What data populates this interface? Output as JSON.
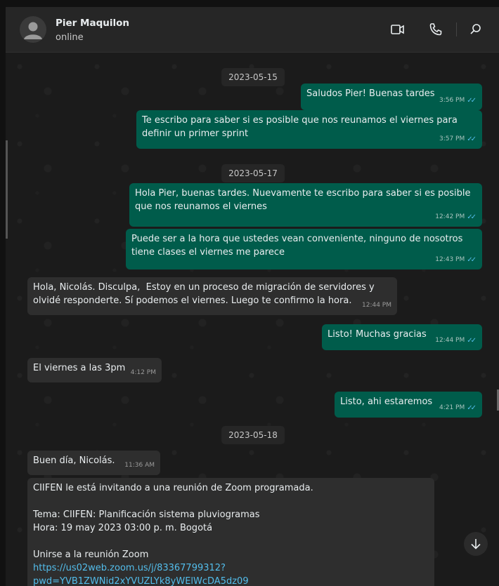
{
  "contact": {
    "name": "Pier Maquilon",
    "status": "online"
  },
  "icons": {
    "video": "video-call-icon",
    "voice": "voice-call-icon",
    "search": "search-icon",
    "scroll": "arrow-down-icon",
    "avatar": "person-avatar-icon"
  },
  "colors": {
    "outgoing": "#005c4b",
    "incoming": "#2e2e2e",
    "tick": "#53bdeb",
    "header": "#262626"
  },
  "dates": [
    "2023-05-15",
    "2023-05-17",
    "2023-05-18"
  ],
  "messages": [
    {
      "text": "Saludos Pier! Buenas tardes",
      "time": "3:56 PM",
      "read": "✓✓"
    },
    {
      "text": "Te escribo para saber si es posible que nos reunamos el viernes para definir un primer sprint",
      "time": "3:57 PM",
      "read": "✓✓"
    },
    {
      "text": "Hola Pier, buenas tardes. Nuevamente te escribo para saber si es posible que nos reunamos el viernes",
      "time": "12:42 PM",
      "read": "✓✓"
    },
    {
      "text": "Puede ser a la hora que ustedes vean conveniente, ninguno de nosotros tiene clases el viernes me parece",
      "time": "12:43 PM",
      "read": "✓✓"
    },
    {
      "text": "Hola, Nicolás. Disculpa,  Estoy en un proceso de migración de servidores y olvidé responderte. Sí podemos el viernes. Luego te confirmo la hora.",
      "time": "12:44 PM"
    },
    {
      "text": "Listo! Muchas gracias",
      "time": "12:44 PM",
      "read": "✓✓"
    },
    {
      "text": "El viernes a las 3pm",
      "time": "4:12 PM"
    },
    {
      "text": "Listo, ahi estaremos",
      "time": "4:21 PM",
      "read": "✓✓"
    },
    {
      "text": "Buen día, Nicolás.",
      "time": "11:36 AM"
    },
    {
      "line1": "CIIFEN le está invitando a una reunión de Zoom programada.",
      "line2": "Tema: CIIFEN: Planificación sistema pluviogramas",
      "line3": "Hora: 19 may 2023 03:00 p. m. Bogotá",
      "line4": "Unirse a la reunión Zoom",
      "link": "https://us02web.zoom.us/j/83367799312?pwd=YVB1ZWNid2xYVUZLYk8yWElWcDA5dz09"
    }
  ]
}
